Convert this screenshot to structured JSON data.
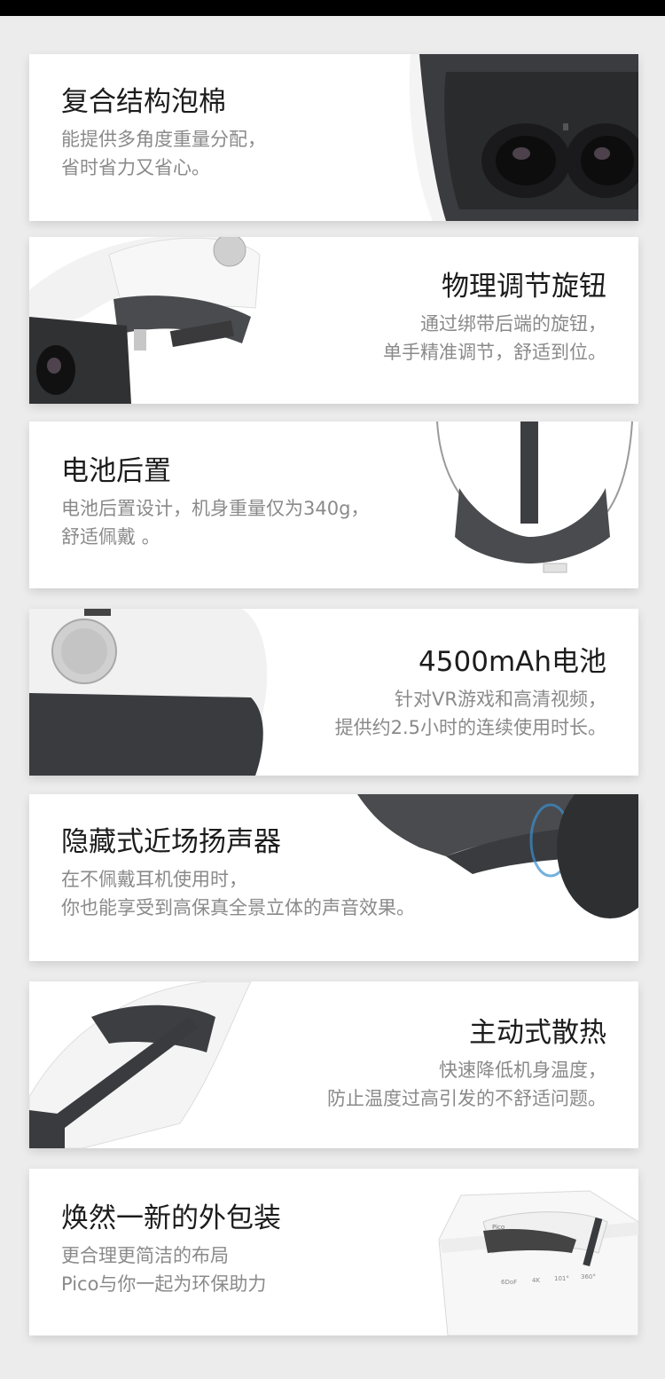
{
  "features": [
    {
      "title": "复合结构泡棉",
      "desc1": "能提供多角度重量分配，",
      "desc2": "省时省力又省心。"
    },
    {
      "title": "物理调节旋钮",
      "desc1": "通过绑带后端的旋钮，",
      "desc2": "单手精准调节，舒适到位。"
    },
    {
      "title": "电池后置",
      "desc1": "电池后置设计，机身重量仅为340g，",
      "desc2": "舒适佩戴 。"
    },
    {
      "title": "4500mAh电池",
      "desc1": "针对VR游戏和高清视频，",
      "desc2": "提供约2.5小时的连续使用时长。"
    },
    {
      "title": "隐藏式近场扬声器",
      "desc1": "在不佩戴耳机使用时，",
      "desc2": "你也能享受到高保真全景立体的声音效果。"
    },
    {
      "title": "主动式散热",
      "desc1": "快速降低机身温度，",
      "desc2": "防止温度过高引发的不舒适问题。"
    },
    {
      "title": "焕然一新的外包装",
      "desc1": "更合理更简洁的布局",
      "desc2": "Pico与你一起为环保助力"
    }
  ],
  "package_box": {
    "brand": "Pico",
    "specs": [
      "6DoF",
      "4K",
      "101°",
      "360°"
    ]
  }
}
